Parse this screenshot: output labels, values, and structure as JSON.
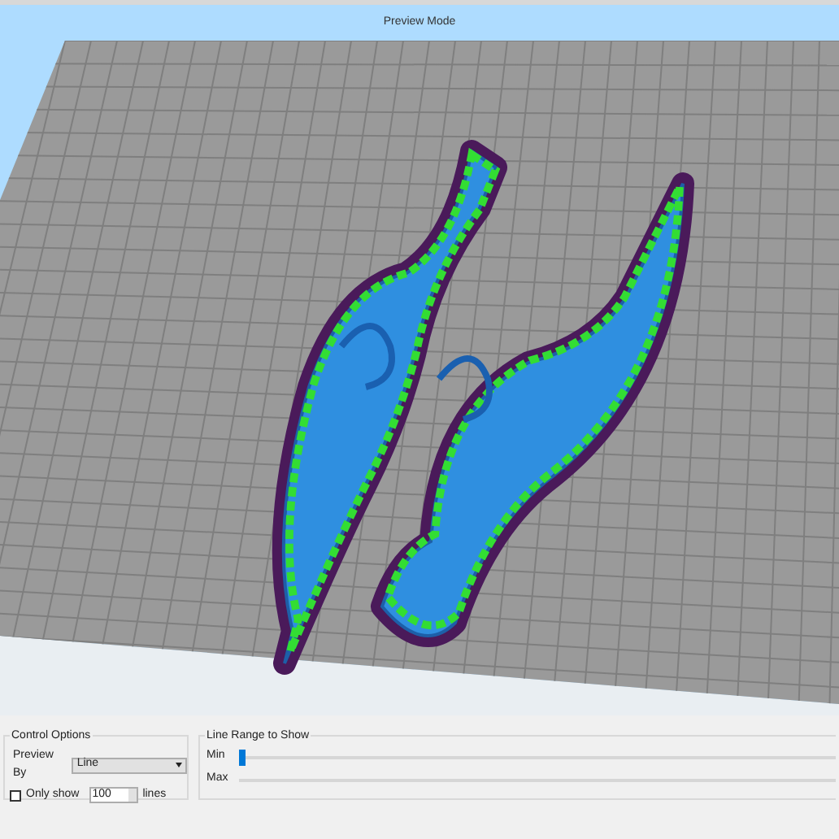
{
  "viewport": {
    "title": "Preview Mode"
  },
  "control_options": {
    "title": "Control Options",
    "preview_by": {
      "label": "Preview By",
      "value": "Line"
    },
    "only_show": {
      "label": "Only show",
      "checked": false,
      "value": "100",
      "unit": "lines"
    }
  },
  "line_range": {
    "title": "Line Range to Show",
    "sliders": [
      {
        "label": "Min",
        "level": 0
      },
      {
        "label": "Max"
      }
    ]
  }
}
